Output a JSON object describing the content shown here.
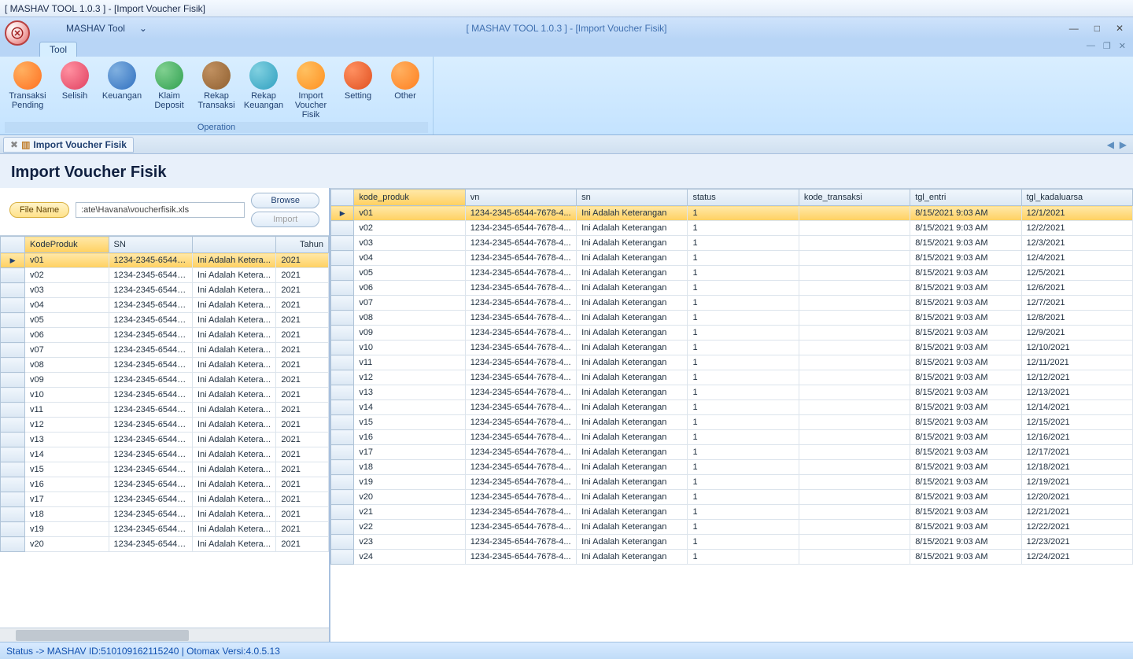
{
  "window": {
    "title": "[ MASHAV TOOL 1.0.3 ] - [Import Voucher Fisik]",
    "qat_label": "MASHAV Tool",
    "center_title": "[ MASHAV TOOL 1.0.3 ] - [Import Voucher Fisik]"
  },
  "ribbon": {
    "tab": "Tool",
    "group_label": "Operation",
    "buttons": [
      {
        "label": "Transaksi Pending",
        "color1": "#ffb060",
        "color2": "#ff7020"
      },
      {
        "label": "Selisih",
        "color1": "#ff90a0",
        "color2": "#e04060"
      },
      {
        "label": "Keuangan",
        "color1": "#80b0e0",
        "color2": "#3070c0"
      },
      {
        "label": "Klaim Deposit",
        "color1": "#80d090",
        "color2": "#30a050"
      },
      {
        "label": "Rekap Transaksi",
        "color1": "#c09060",
        "color2": "#906030"
      },
      {
        "label": "Rekap Keuangan",
        "color1": "#80d0e0",
        "color2": "#30a0c0"
      },
      {
        "label": "Import Voucher Fisik",
        "color1": "#ffc060",
        "color2": "#ff9020"
      },
      {
        "label": "Setting",
        "color1": "#ff9060",
        "color2": "#e05020"
      },
      {
        "label": "Other",
        "color1": "#ffb060",
        "color2": "#ff8020"
      }
    ]
  },
  "doc_tab": {
    "label": "Import Voucher Fisik"
  },
  "page": {
    "title": "Import Voucher Fisik",
    "file_label": "File Name",
    "file_value": ":ate\\Havana\\voucherfisik.xls",
    "browse": "Browse",
    "import": "Import"
  },
  "left_grid": {
    "headers": [
      "KodeProduk",
      "SN",
      "",
      "Tahun"
    ],
    "rows": [
      [
        "v01",
        "1234-2345-6544-...",
        "Ini Adalah Ketera...",
        "2021"
      ],
      [
        "v02",
        "1234-2345-6544-...",
        "Ini Adalah Ketera...",
        "2021"
      ],
      [
        "v03",
        "1234-2345-6544-...",
        "Ini Adalah Ketera...",
        "2021"
      ],
      [
        "v04",
        "1234-2345-6544-...",
        "Ini Adalah Ketera...",
        "2021"
      ],
      [
        "v05",
        "1234-2345-6544-...",
        "Ini Adalah Ketera...",
        "2021"
      ],
      [
        "v06",
        "1234-2345-6544-...",
        "Ini Adalah Ketera...",
        "2021"
      ],
      [
        "v07",
        "1234-2345-6544-...",
        "Ini Adalah Ketera...",
        "2021"
      ],
      [
        "v08",
        "1234-2345-6544-...",
        "Ini Adalah Ketera...",
        "2021"
      ],
      [
        "v09",
        "1234-2345-6544-...",
        "Ini Adalah Ketera...",
        "2021"
      ],
      [
        "v10",
        "1234-2345-6544-...",
        "Ini Adalah Ketera...",
        "2021"
      ],
      [
        "v11",
        "1234-2345-6544-...",
        "Ini Adalah Ketera...",
        "2021"
      ],
      [
        "v12",
        "1234-2345-6544-...",
        "Ini Adalah Ketera...",
        "2021"
      ],
      [
        "v13",
        "1234-2345-6544-...",
        "Ini Adalah Ketera...",
        "2021"
      ],
      [
        "v14",
        "1234-2345-6544-...",
        "Ini Adalah Ketera...",
        "2021"
      ],
      [
        "v15",
        "1234-2345-6544-...",
        "Ini Adalah Ketera...",
        "2021"
      ],
      [
        "v16",
        "1234-2345-6544-...",
        "Ini Adalah Ketera...",
        "2021"
      ],
      [
        "v17",
        "1234-2345-6544-...",
        "Ini Adalah Ketera...",
        "2021"
      ],
      [
        "v18",
        "1234-2345-6544-...",
        "Ini Adalah Ketera...",
        "2021"
      ],
      [
        "v19",
        "1234-2345-6544-...",
        "Ini Adalah Ketera...",
        "2021"
      ],
      [
        "v20",
        "1234-2345-6544-...",
        "Ini Adalah Ketera...",
        "2021"
      ]
    ]
  },
  "right_grid": {
    "headers": [
      "kode_produk",
      "vn",
      "sn",
      "status",
      "kode_transaksi",
      "tgl_entri",
      "tgl_kadaluarsa"
    ],
    "rows": [
      [
        "v01",
        "1234-2345-6544-7678-4...",
        "Ini Adalah Keterangan",
        "1",
        "",
        "8/15/2021 9:03 AM",
        "12/1/2021"
      ],
      [
        "v02",
        "1234-2345-6544-7678-4...",
        "Ini Adalah Keterangan",
        "1",
        "",
        "8/15/2021 9:03 AM",
        "12/2/2021"
      ],
      [
        "v03",
        "1234-2345-6544-7678-4...",
        "Ini Adalah Keterangan",
        "1",
        "",
        "8/15/2021 9:03 AM",
        "12/3/2021"
      ],
      [
        "v04",
        "1234-2345-6544-7678-4...",
        "Ini Adalah Keterangan",
        "1",
        "",
        "8/15/2021 9:03 AM",
        "12/4/2021"
      ],
      [
        "v05",
        "1234-2345-6544-7678-4...",
        "Ini Adalah Keterangan",
        "1",
        "",
        "8/15/2021 9:03 AM",
        "12/5/2021"
      ],
      [
        "v06",
        "1234-2345-6544-7678-4...",
        "Ini Adalah Keterangan",
        "1",
        "",
        "8/15/2021 9:03 AM",
        "12/6/2021"
      ],
      [
        "v07",
        "1234-2345-6544-7678-4...",
        "Ini Adalah Keterangan",
        "1",
        "",
        "8/15/2021 9:03 AM",
        "12/7/2021"
      ],
      [
        "v08",
        "1234-2345-6544-7678-4...",
        "Ini Adalah Keterangan",
        "1",
        "",
        "8/15/2021 9:03 AM",
        "12/8/2021"
      ],
      [
        "v09",
        "1234-2345-6544-7678-4...",
        "Ini Adalah Keterangan",
        "1",
        "",
        "8/15/2021 9:03 AM",
        "12/9/2021"
      ],
      [
        "v10",
        "1234-2345-6544-7678-4...",
        "Ini Adalah Keterangan",
        "1",
        "",
        "8/15/2021 9:03 AM",
        "12/10/2021"
      ],
      [
        "v11",
        "1234-2345-6544-7678-4...",
        "Ini Adalah Keterangan",
        "1",
        "",
        "8/15/2021 9:03 AM",
        "12/11/2021"
      ],
      [
        "v12",
        "1234-2345-6544-7678-4...",
        "Ini Adalah Keterangan",
        "1",
        "",
        "8/15/2021 9:03 AM",
        "12/12/2021"
      ],
      [
        "v13",
        "1234-2345-6544-7678-4...",
        "Ini Adalah Keterangan",
        "1",
        "",
        "8/15/2021 9:03 AM",
        "12/13/2021"
      ],
      [
        "v14",
        "1234-2345-6544-7678-4...",
        "Ini Adalah Keterangan",
        "1",
        "",
        "8/15/2021 9:03 AM",
        "12/14/2021"
      ],
      [
        "v15",
        "1234-2345-6544-7678-4...",
        "Ini Adalah Keterangan",
        "1",
        "",
        "8/15/2021 9:03 AM",
        "12/15/2021"
      ],
      [
        "v16",
        "1234-2345-6544-7678-4...",
        "Ini Adalah Keterangan",
        "1",
        "",
        "8/15/2021 9:03 AM",
        "12/16/2021"
      ],
      [
        "v17",
        "1234-2345-6544-7678-4...",
        "Ini Adalah Keterangan",
        "1",
        "",
        "8/15/2021 9:03 AM",
        "12/17/2021"
      ],
      [
        "v18",
        "1234-2345-6544-7678-4...",
        "Ini Adalah Keterangan",
        "1",
        "",
        "8/15/2021 9:03 AM",
        "12/18/2021"
      ],
      [
        "v19",
        "1234-2345-6544-7678-4...",
        "Ini Adalah Keterangan",
        "1",
        "",
        "8/15/2021 9:03 AM",
        "12/19/2021"
      ],
      [
        "v20",
        "1234-2345-6544-7678-4...",
        "Ini Adalah Keterangan",
        "1",
        "",
        "8/15/2021 9:03 AM",
        "12/20/2021"
      ],
      [
        "v21",
        "1234-2345-6544-7678-4...",
        "Ini Adalah Keterangan",
        "1",
        "",
        "8/15/2021 9:03 AM",
        "12/21/2021"
      ],
      [
        "v22",
        "1234-2345-6544-7678-4...",
        "Ini Adalah Keterangan",
        "1",
        "",
        "8/15/2021 9:03 AM",
        "12/22/2021"
      ],
      [
        "v23",
        "1234-2345-6544-7678-4...",
        "Ini Adalah Keterangan",
        "1",
        "",
        "8/15/2021 9:03 AM",
        "12/23/2021"
      ],
      [
        "v24",
        "1234-2345-6544-7678-4...",
        "Ini Adalah Keterangan",
        "1",
        "",
        "8/15/2021 9:03 AM",
        "12/24/2021"
      ]
    ]
  },
  "statusbar": {
    "text": "Status -> MASHAV ID:510109162115240 | Otomax Versi:4.0.5.13"
  }
}
